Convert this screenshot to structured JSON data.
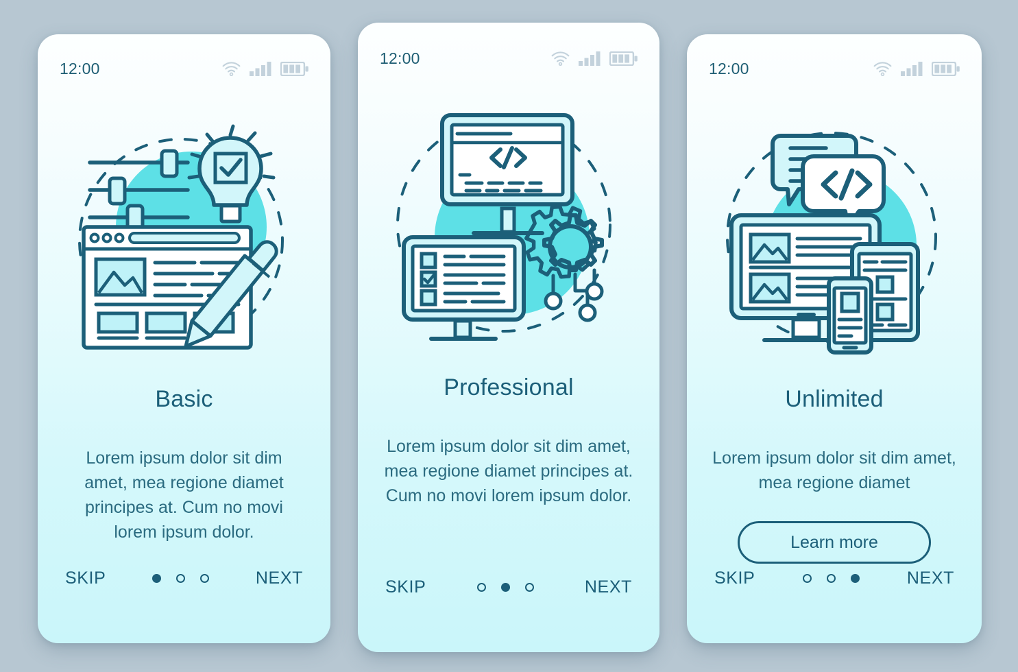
{
  "colors": {
    "page_background": "#b7c7d2",
    "card_top": "#fdffff",
    "card_bottom": "#caf6fa",
    "accent_teal": "#5de0e6",
    "stroke": "#1c5f79",
    "text": "#2b6b80",
    "status_icon": "#c3d2dc"
  },
  "screens": [
    {
      "status": {
        "time": "12:00",
        "icons": [
          "wifi-icon",
          "signal-icon",
          "battery-icon"
        ]
      },
      "illustration": {
        "name": "website-builder-illustration",
        "elements": [
          "slider-controls",
          "lightbulb-with-check",
          "browser-window",
          "image-placeholder",
          "content-blocks",
          "pencil",
          "dashed-circle",
          "teal-circle"
        ]
      },
      "title": "Basic",
      "body": "Lorem ipsum dolor sit dim amet, mea regione diamet principes at. Cum no movi lorem ipsum dolor.",
      "has_learn_more": false,
      "learn_more_label": "",
      "skip_label": "SKIP",
      "next_label": "NEXT",
      "dots": 3,
      "active_dot": 0
    },
    {
      "status": {
        "time": "12:00",
        "icons": [
          "wifi-icon",
          "signal-icon",
          "battery-icon"
        ]
      },
      "illustration": {
        "name": "development-illustration",
        "elements": [
          "monitor-with-code",
          "code-tag",
          "monitor-with-checklist",
          "gear-icon",
          "circuit-nodes",
          "dashed-circle",
          "teal-circle"
        ]
      },
      "title": "Professional",
      "body": "Lorem ipsum dolor sit dim amet, mea regione diamet principes at. Cum no movi lorem ipsum dolor.",
      "has_learn_more": false,
      "learn_more_label": "",
      "skip_label": "SKIP",
      "next_label": "NEXT",
      "dots": 3,
      "active_dot": 1
    },
    {
      "status": {
        "time": "12:00",
        "icons": [
          "wifi-icon",
          "signal-icon",
          "battery-icon"
        ]
      },
      "illustration": {
        "name": "responsive-devices-illustration",
        "elements": [
          "chat-bubble-text",
          "chat-bubble-code",
          "desktop-monitor",
          "tablet",
          "smartphone",
          "dashed-circle",
          "teal-circle"
        ]
      },
      "title": "Unlimited",
      "body": "Lorem ipsum dolor sit dim amet, mea regione diamet",
      "has_learn_more": true,
      "learn_more_label": "Learn more",
      "skip_label": "SKIP",
      "next_label": "NEXT",
      "dots": 3,
      "active_dot": 2
    }
  ]
}
